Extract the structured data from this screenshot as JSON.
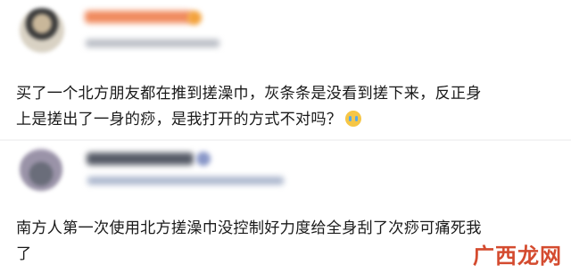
{
  "posts": [
    {
      "lines": [
        "买了一个北方朋友都在推到搓澡巾，灰条条是没看到搓下来，反正身",
        "上是搓出了一身的痧，是我打开的方式不对吗？"
      ],
      "emoji": "crying-face-icon"
    },
    {
      "lines": [
        "南方人第一次使用北方搓澡巾没控制好力度给全身刮了次痧可痛死我",
        "了"
      ]
    }
  ],
  "watermark": "广西龙网",
  "colors": {
    "background": "#f4f4f5",
    "card": "#ffffff",
    "text": "#1a1a1a",
    "watermark": "#d44b2f"
  }
}
